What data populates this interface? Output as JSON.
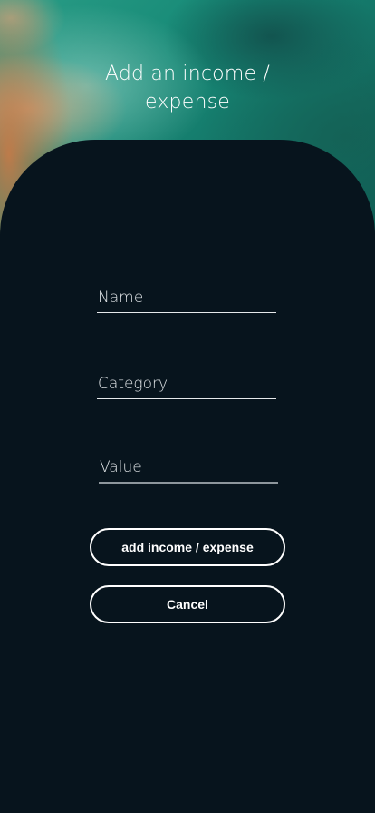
{
  "header": {
    "title_line1": "Add an income /",
    "title_line2": "expense"
  },
  "form": {
    "name_placeholder": "Name",
    "name_value": "",
    "category_placeholder": "Category",
    "category_value": "",
    "value_placeholder": "Value",
    "value_value": ""
  },
  "actions": {
    "submit_label": "add income / expense",
    "cancel_label": "Cancel"
  },
  "colors": {
    "panel_background": "#07141d",
    "text": "#ffffff",
    "water_accent": "#178a77",
    "sand_accent": "#c47a48"
  }
}
